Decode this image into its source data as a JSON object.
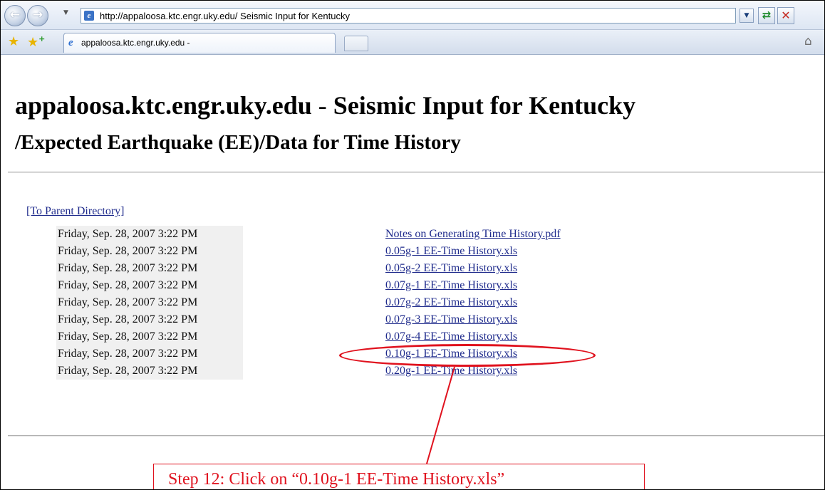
{
  "browser": {
    "address_url": "http://appaloosa.ktc.engr.uky.edu/ Seismic Input for Kentucky",
    "tab_title": "appaloosa.ktc.engr.uky.edu -",
    "icons": {
      "back": "back-arrow-icon",
      "forward": "forward-arrow-icon",
      "refresh": "refresh-icon",
      "stop": "stop-icon",
      "home": "home-icon",
      "favorites": "star-icon",
      "add_favorite": "add-favorite-icon"
    }
  },
  "page": {
    "title_host": "appaloosa.ktc.engr.uky.edu",
    "title_sep": " - ",
    "title_rest": "Seismic Input for Kentucky",
    "subtitle": "/Expected Earthquake (EE)/Data for Time History",
    "parent_link": "[To Parent Directory]",
    "entries": [
      {
        "date": "Friday, Sep. 28, 2007 3:22 PM",
        "name": "Notes on Generating Time History.pdf"
      },
      {
        "date": "Friday, Sep. 28, 2007 3:22 PM",
        "name": "0.05g-1 EE-Time History.xls"
      },
      {
        "date": "Friday, Sep. 28, 2007 3:22 PM",
        "name": "0.05g-2 EE-Time History.xls"
      },
      {
        "date": "Friday, Sep. 28, 2007 3:22 PM",
        "name": "0.07g-1 EE-Time History.xls"
      },
      {
        "date": "Friday, Sep. 28, 2007 3:22 PM",
        "name": "0.07g-2 EE-Time History.xls"
      },
      {
        "date": "Friday, Sep. 28, 2007 3:22 PM",
        "name": "0.07g-3 EE-Time History.xls"
      },
      {
        "date": "Friday, Sep. 28, 2007 3:22 PM",
        "name": "0.07g-4 EE-Time History.xls"
      },
      {
        "date": "Friday, Sep. 28, 2007 3:22 PM",
        "name": "0.10g-1 EE-Time History.xls"
      },
      {
        "date": "Friday, Sep. 28, 2007 3:22 PM",
        "name": "0.20g-1 EE-Time History.xls"
      }
    ]
  },
  "annotation": {
    "callout_text": "Step 12: Click on “0.10g-1 EE-Time History.xls”",
    "color": "#e0121e"
  }
}
